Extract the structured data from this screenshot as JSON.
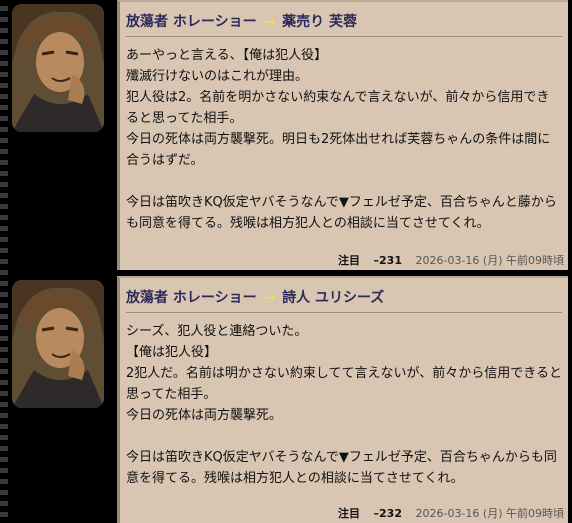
{
  "posts": [
    {
      "speaker": "放蕩者 ホレーショー",
      "arrow": "→",
      "target": "薬売り 芙蓉",
      "content": "あーやっと言える、【俺は犯人役】\n殲滅行けないのはこれが理由。\n犯人役は2。名前を明かさない約束なんで言えないが、前々から信用できると思ってた相手。\n今日の死体は両方襲撃死。明日も2死体出せれば芙蓉ちゃんの条件は間に合うはずだ。\n\n今日は笛吹きKQ仮定ヤバそうなんで▼フェルゼ予定、百合ちゃんと藤からも同意を得てる。残喉は相方犯人との相談に当てさせてくれ。",
      "attention": "注目",
      "number": "–231",
      "timestamp": "2026-03-16 (月) 午前09時頃"
    },
    {
      "speaker": "放蕩者 ホレーショー",
      "arrow": "→",
      "target": "詩人 ユリシーズ",
      "content": "シーズ、犯人役と連絡ついた。\n【俺は犯人役】\n2犯人だ。名前は明かさない約束してて言えないが、前々から信用できると思ってた相手。\n今日の死体は両方襲撃死。\n\n今日は笛吹きKQ仮定ヤバそうなんで▼フェルゼ予定、百合ちゃんからも同意を得てる。残喉は相方犯人との相談に当てさせてくれ。",
      "attention": "注目",
      "number": "–232",
      "timestamp": "2026-03-16 (月) 午前09時頃"
    }
  ]
}
